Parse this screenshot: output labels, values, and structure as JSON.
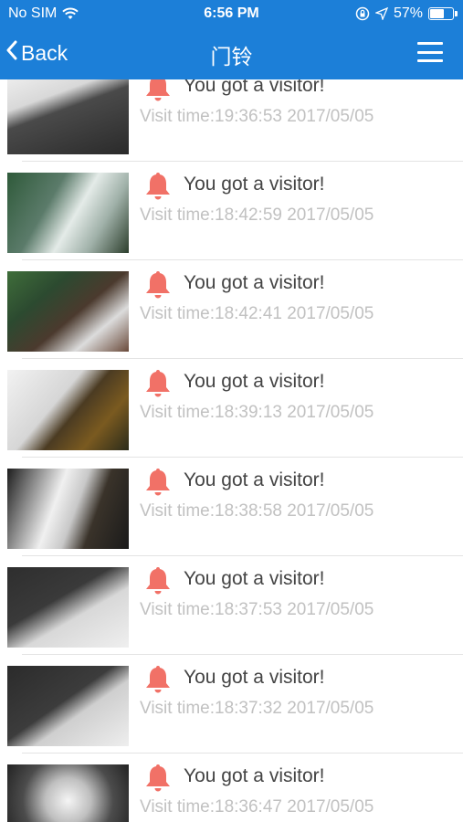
{
  "status_bar": {
    "carrier": "No SIM",
    "time": "6:56 PM",
    "battery": "57%",
    "battery_level": 0.57
  },
  "nav": {
    "back_label": "Back",
    "title": "门铃",
    "menu_icon": "hamburger-menu-icon"
  },
  "colors": {
    "header_bg": "#1c7fd8",
    "bell": "#f17167",
    "time_text": "#c1c1c1"
  },
  "visits": [
    {
      "message": "You got a visitor!",
      "time": "Visit time:19:36:53 2017/05/05"
    },
    {
      "message": "You got a visitor!",
      "time": "Visit time:18:42:59 2017/05/05"
    },
    {
      "message": "You got a visitor!",
      "time": "Visit time:18:42:41 2017/05/05"
    },
    {
      "message": "You got a visitor!",
      "time": "Visit time:18:39:13 2017/05/05"
    },
    {
      "message": "You got a visitor!",
      "time": "Visit time:18:38:58 2017/05/05"
    },
    {
      "message": "You got a visitor!",
      "time": "Visit time:18:37:53 2017/05/05"
    },
    {
      "message": "You got a visitor!",
      "time": "Visit time:18:37:32 2017/05/05"
    },
    {
      "message": "You got a visitor!",
      "time": "Visit time:18:36:47 2017/05/05"
    }
  ]
}
